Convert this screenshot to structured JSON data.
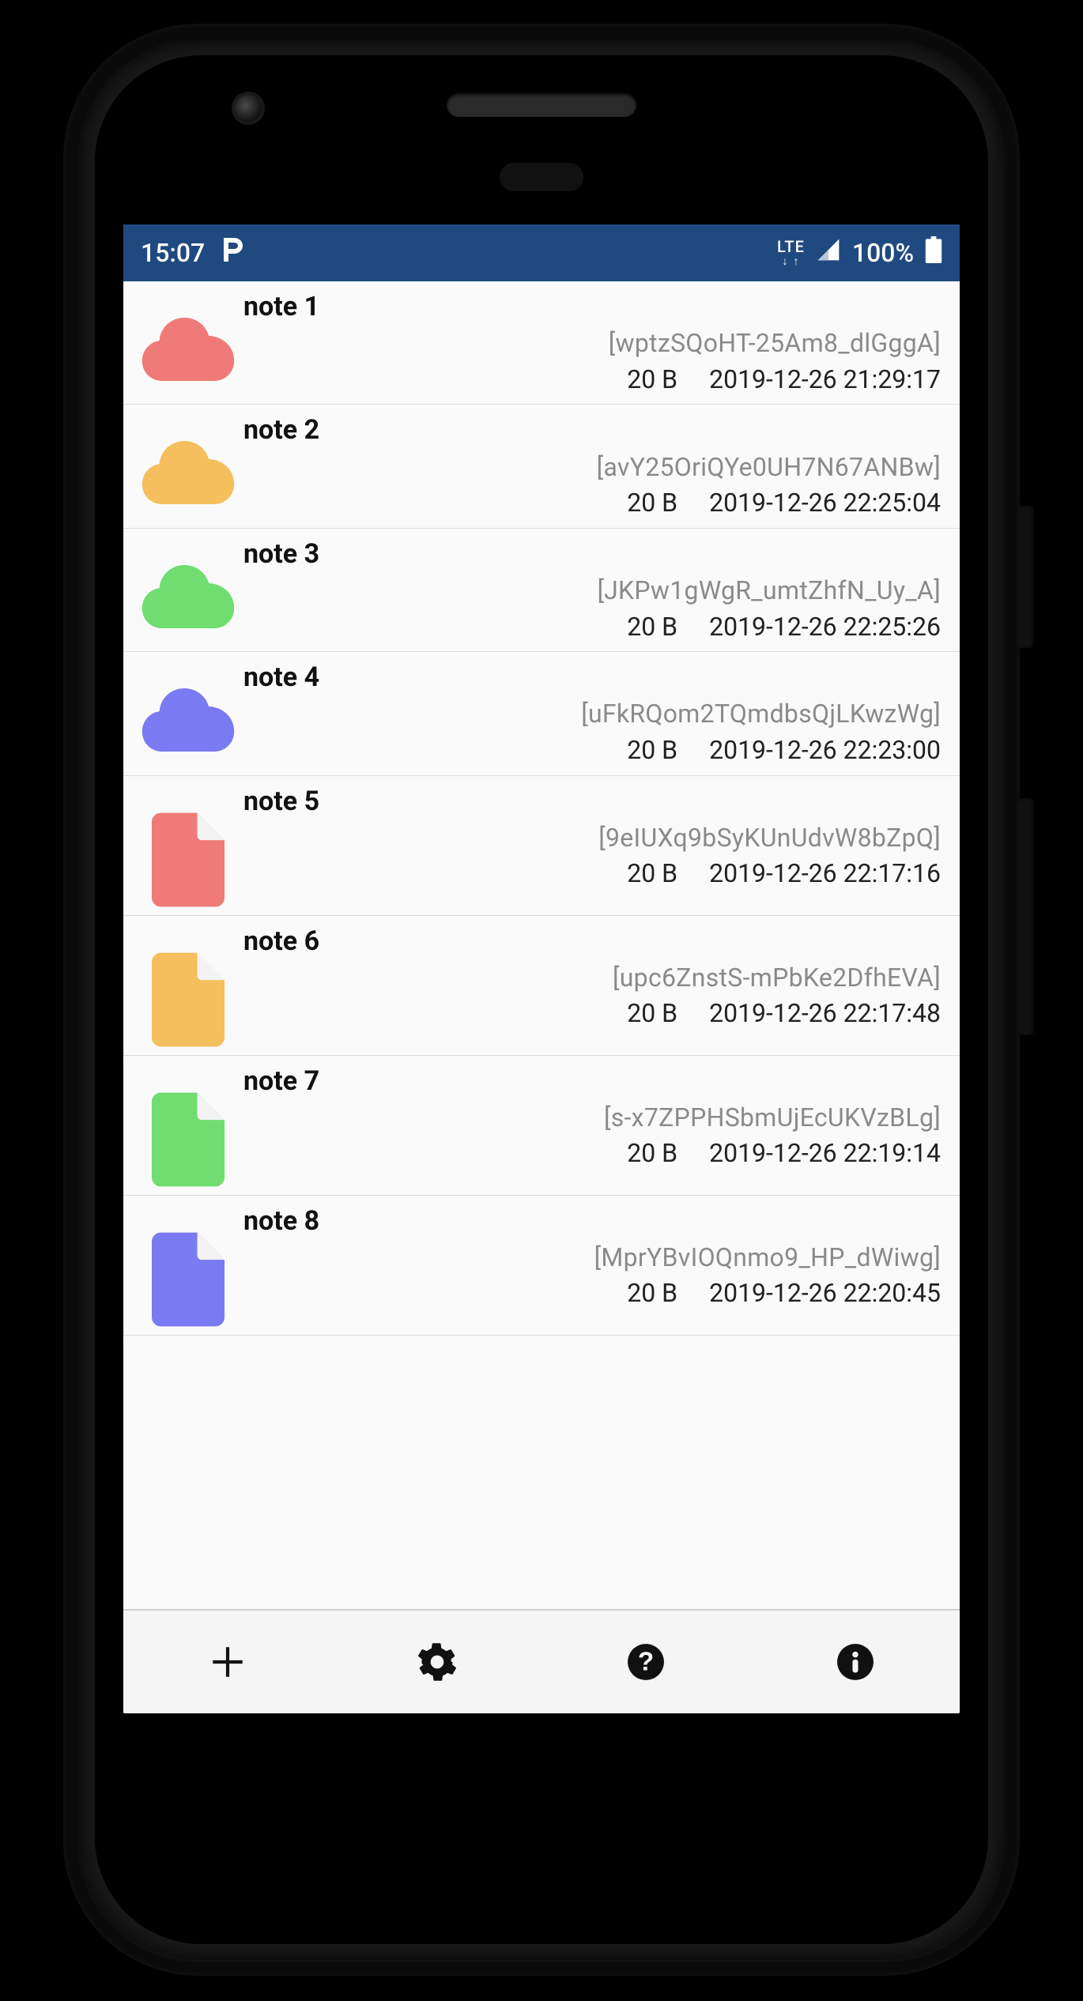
{
  "status": {
    "time": "15:07",
    "net_label": "LTE",
    "battery_pct": "100%"
  },
  "colors": {
    "red": "#ef7a77",
    "orange": "#f5bf5d",
    "green": "#70dd70",
    "blue": "#7a7af2"
  },
  "icon_types": {
    "cloud": "cloud",
    "document": "document"
  },
  "notes": [
    {
      "title": "note 1",
      "hash": "[wptzSQoHT-25Am8_dlGggA]",
      "size": "20 B",
      "ts": "2019-12-26 21:29:17",
      "icon": "cloud",
      "color": "red"
    },
    {
      "title": "note 2",
      "hash": "[avY25OriQYe0UH7N67ANBw]",
      "size": "20 B",
      "ts": "2019-12-26 22:25:04",
      "icon": "cloud",
      "color": "orange"
    },
    {
      "title": "note 3",
      "hash": "[JKPw1gWgR_umtZhfN_Uy_A]",
      "size": "20 B",
      "ts": "2019-12-26 22:25:26",
      "icon": "cloud",
      "color": "green"
    },
    {
      "title": "note 4",
      "hash": "[uFkRQom2TQmdbsQjLKwzWg]",
      "size": "20 B",
      "ts": "2019-12-26 22:23:00",
      "icon": "cloud",
      "color": "blue"
    },
    {
      "title": "note 5",
      "hash": "[9eIUXq9bSyKUnUdvW8bZpQ]",
      "size": "20 B",
      "ts": "2019-12-26 22:17:16",
      "icon": "document",
      "color": "red"
    },
    {
      "title": "note 6",
      "hash": "[upc6ZnstS-mPbKe2DfhEVA]",
      "size": "20 B",
      "ts": "2019-12-26 22:17:48",
      "icon": "document",
      "color": "orange"
    },
    {
      "title": "note 7",
      "hash": "[s-x7ZPPHSbmUjEcUKVzBLg]",
      "size": "20 B",
      "ts": "2019-12-26 22:19:14",
      "icon": "document",
      "color": "green"
    },
    {
      "title": "note 8",
      "hash": "[MprYBvIOQnmo9_HP_dWiwg]",
      "size": "20 B",
      "ts": "2019-12-26 22:20:45",
      "icon": "document",
      "color": "blue"
    }
  ],
  "toolbar": {
    "add": "add",
    "settings": "settings",
    "help": "help",
    "info": "info"
  }
}
